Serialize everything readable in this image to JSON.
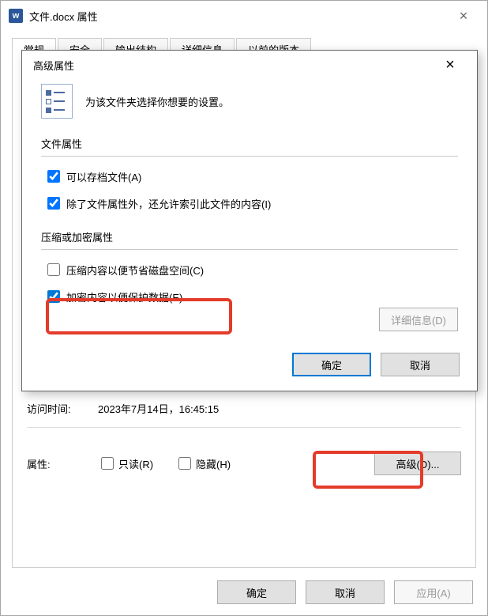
{
  "outer": {
    "title": "文件.docx 属性",
    "tabs": [
      "常规",
      "安全",
      "输出结构",
      "详细信息",
      "以前的版本"
    ],
    "visitTimeLabel": "访问时间:",
    "visitTimeValue": "2023年7月14日，16:45:15",
    "attrLabel": "属性:",
    "readOnly": "只读(R)",
    "hidden": "隐藏(H)",
    "advancedBtn": "高级(D)...",
    "ok": "确定",
    "cancel": "取消",
    "apply": "应用(A)"
  },
  "inner": {
    "title": "高级属性",
    "intro": "为该文件夹选择你想要的设置。",
    "group1": {
      "label": "文件属性",
      "archive": "可以存档文件(A)",
      "index": "除了文件属性外，还允许索引此文件的内容(I)"
    },
    "group2": {
      "label": "压缩或加密属性",
      "compress": "压缩内容以便节省磁盘空间(C)",
      "encrypt": "加密内容以便保护数据(E)"
    },
    "details": "详细信息(D)",
    "ok": "确定",
    "cancel": "取消"
  }
}
